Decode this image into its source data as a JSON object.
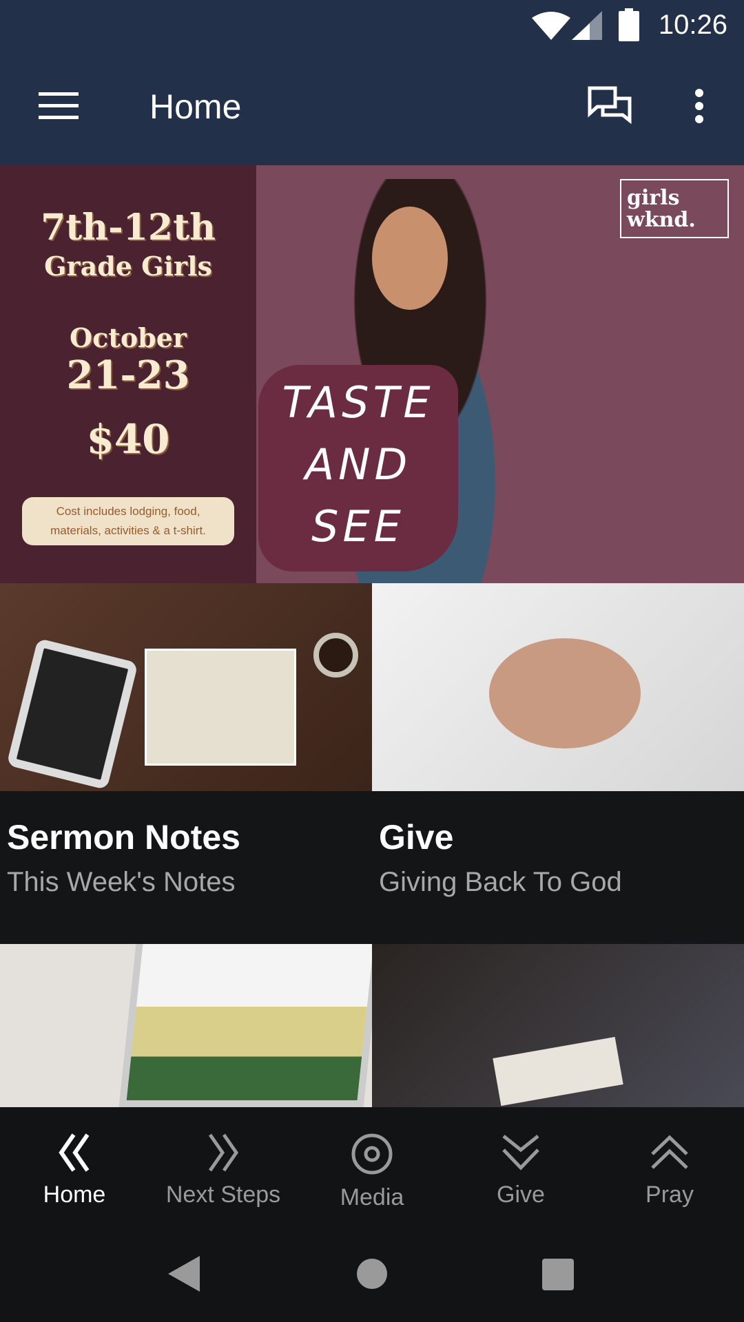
{
  "status_bar": {
    "time": "10:26",
    "icons": [
      "wifi-icon",
      "signal-icon",
      "battery-icon"
    ]
  },
  "app_bar": {
    "title": "Home",
    "icons": [
      "menu-icon",
      "chat-icon",
      "more-vert-icon"
    ]
  },
  "banner": {
    "grade": "7th-12th",
    "audience": "Grade Girls",
    "month": "October",
    "dates": "21-23",
    "price": "$40",
    "note_line1": "Cost includes lodging, food,",
    "note_line2": "materials, activities & a t-shirt.",
    "slogan_1": "TASTE",
    "slogan_2": "AND",
    "slogan_3": "SEE",
    "logo_line1": "girls",
    "logo_line2": "wknd."
  },
  "tiles": [
    {
      "title": "Sermon Notes",
      "subtitle": "This Week's Notes"
    },
    {
      "title": "Give",
      "subtitle": "Giving Back To God"
    }
  ],
  "bottom_nav": [
    {
      "label": "Home",
      "icon": "double-chevron-left-icon",
      "active": true
    },
    {
      "label": "Next Steps",
      "icon": "double-chevron-right-icon"
    },
    {
      "label": "Media",
      "icon": "target-icon"
    },
    {
      "label": "Give",
      "icon": "double-chevron-down-icon"
    },
    {
      "label": "Pray",
      "icon": "double-chevron-up-icon"
    }
  ],
  "colors": {
    "header": "#22304a",
    "background": "#121315",
    "active": "#ffffff",
    "inactive": "#9a9a9a"
  }
}
